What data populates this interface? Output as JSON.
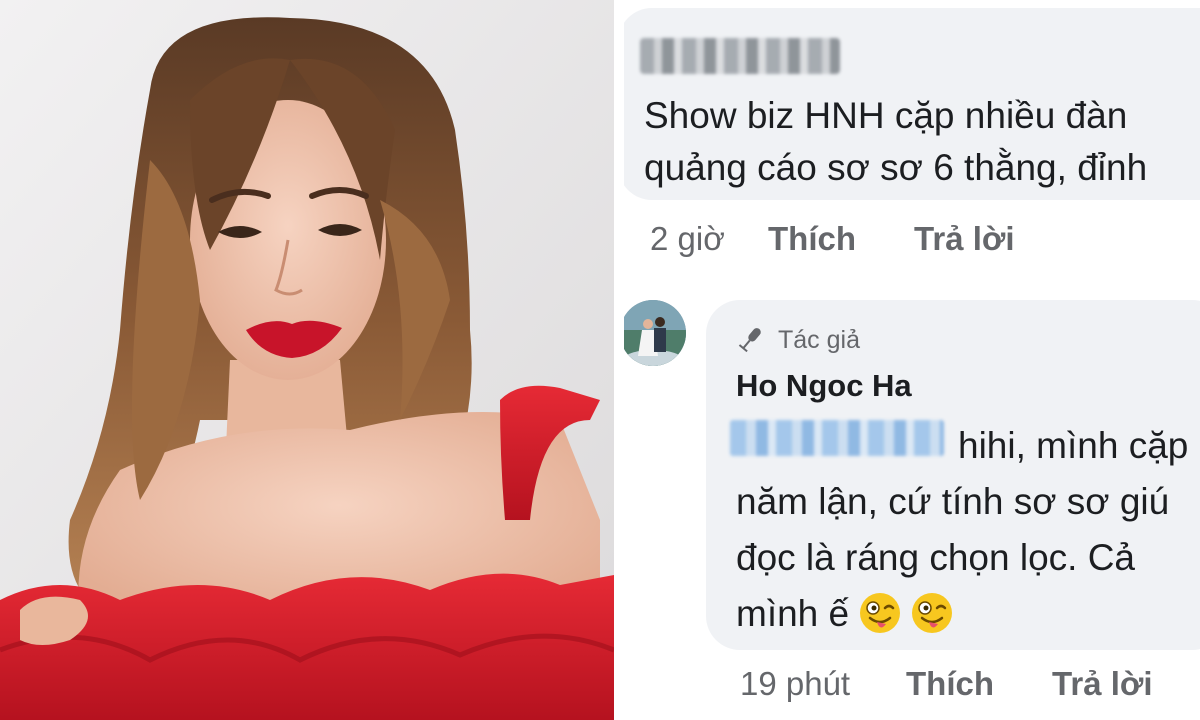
{
  "colors": {
    "bubble": "#f0f2f5",
    "text": "#1c1e21",
    "meta_text": "#65676b",
    "dress_red": "#d41f2c",
    "lipstick": "#c8142a"
  },
  "photo": {
    "icon": "portrait-photo"
  },
  "comment1": {
    "author_blurred": true,
    "lines": [
      "Show biz HNH cặp nhiều đàn",
      "quảng cáo sơ sơ 6 thằng, đỉnh"
    ],
    "time": "2 giờ",
    "like_label": "Thích",
    "reply_label": "Trả lời"
  },
  "reply": {
    "badge_icon": "microphone-icon",
    "badge_label": "Tác giả",
    "author": "Ho Ngoc Ha",
    "tag_blurred": true,
    "line1_rest": "hihi, mình cặp",
    "line2": "năm lận, cứ tính sơ sơ giú",
    "line3": "đọc là ráng chọn lọc. Cả",
    "line4": "mình ế",
    "emojis": [
      "winking-tongue-emoji",
      "winking-tongue-emoji"
    ],
    "time": "19 phút",
    "like_label": "Thích",
    "reply_label": "Trả lời"
  }
}
